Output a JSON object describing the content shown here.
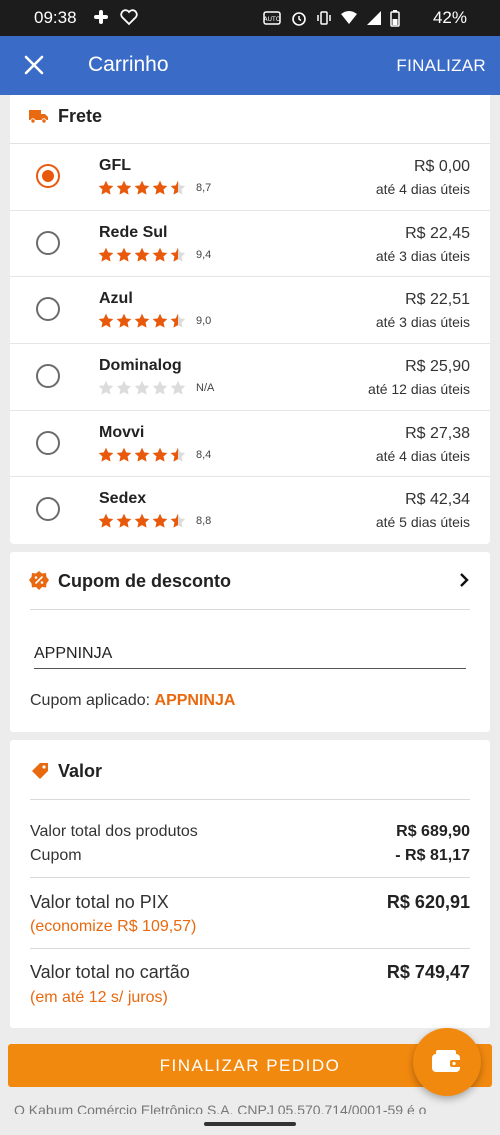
{
  "status_bar": {
    "time": "09:38",
    "battery": "42%"
  },
  "app_bar": {
    "title": "Carrinho",
    "action": "FINALIZAR"
  },
  "shipping": {
    "title": "Frete",
    "options": [
      {
        "name": "GFL",
        "rating": "8,7",
        "stars": 4.5,
        "price": "R$ 0,00",
        "days": "até 4 dias úteis",
        "selected": true
      },
      {
        "name": "Rede Sul",
        "rating": "9,4",
        "stars": 4.5,
        "price": "R$ 22,45",
        "days": "até 3 dias úteis",
        "selected": false
      },
      {
        "name": "Azul",
        "rating": "9,0",
        "stars": 4.5,
        "price": "R$ 22,51",
        "days": "até 3 dias úteis",
        "selected": false
      },
      {
        "name": "Dominalog",
        "rating": "N/A",
        "stars": 0,
        "price": "R$ 25,90",
        "days": "até 12 dias úteis",
        "selected": false
      },
      {
        "name": "Movvi",
        "rating": "8,4",
        "stars": 4.5,
        "price": "R$ 27,38",
        "days": "até 4 dias úteis",
        "selected": false
      },
      {
        "name": "Sedex",
        "rating": "8,8",
        "stars": 4.5,
        "price": "R$ 42,34",
        "days": "até 5 dias úteis",
        "selected": false
      }
    ]
  },
  "coupon": {
    "title": "Cupom de desconto",
    "input_value": "APPNINJA",
    "applied_label": "Cupom aplicado:",
    "applied_code": "APPNINJA"
  },
  "summary": {
    "title": "Valor",
    "products_label": "Valor total dos produtos",
    "products_value": "R$ 689,90",
    "coupon_label": "Cupom",
    "coupon_value": "- R$ 81,17",
    "pix_label": "Valor total no PIX",
    "pix_value": "R$ 620,91",
    "pix_note": "(economize R$ 109,57)",
    "card_label": "Valor total no cartão",
    "card_value": "R$ 749,47",
    "card_note": "(em até 12 s/ juros)"
  },
  "checkout_button": "FINALIZAR PEDIDO",
  "footer": "O Kabum Comércio Eletrônico S.A. CNPJ 05.570.714/0001-59 é o",
  "colors": {
    "brand_blue": "#3a6bc7",
    "accent_orange": "#f2890f",
    "star_orange": "#e8590c"
  }
}
